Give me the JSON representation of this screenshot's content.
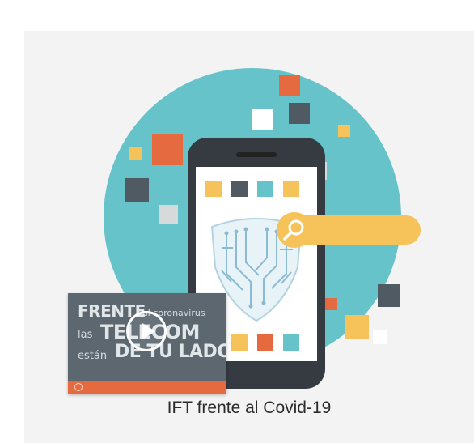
{
  "caption": "IFT frente al Covid-19",
  "video": {
    "line1_bold": "FRENTE",
    "line1_small": "al coronavirus",
    "line2_small": "las",
    "line2_bold": "TELECOM",
    "line3_small": "están",
    "line3_bold": "DE TU LADO",
    "play_icon": "play-icon"
  },
  "colors": {
    "teal_circle": "#66c3c9",
    "orange": "#e66a3f",
    "yellow": "#f6c35b",
    "slate": "#4f5a63",
    "phone_body": "#353b41",
    "video_bg": "#5c6770",
    "card_bg": "#f3f3f3"
  }
}
